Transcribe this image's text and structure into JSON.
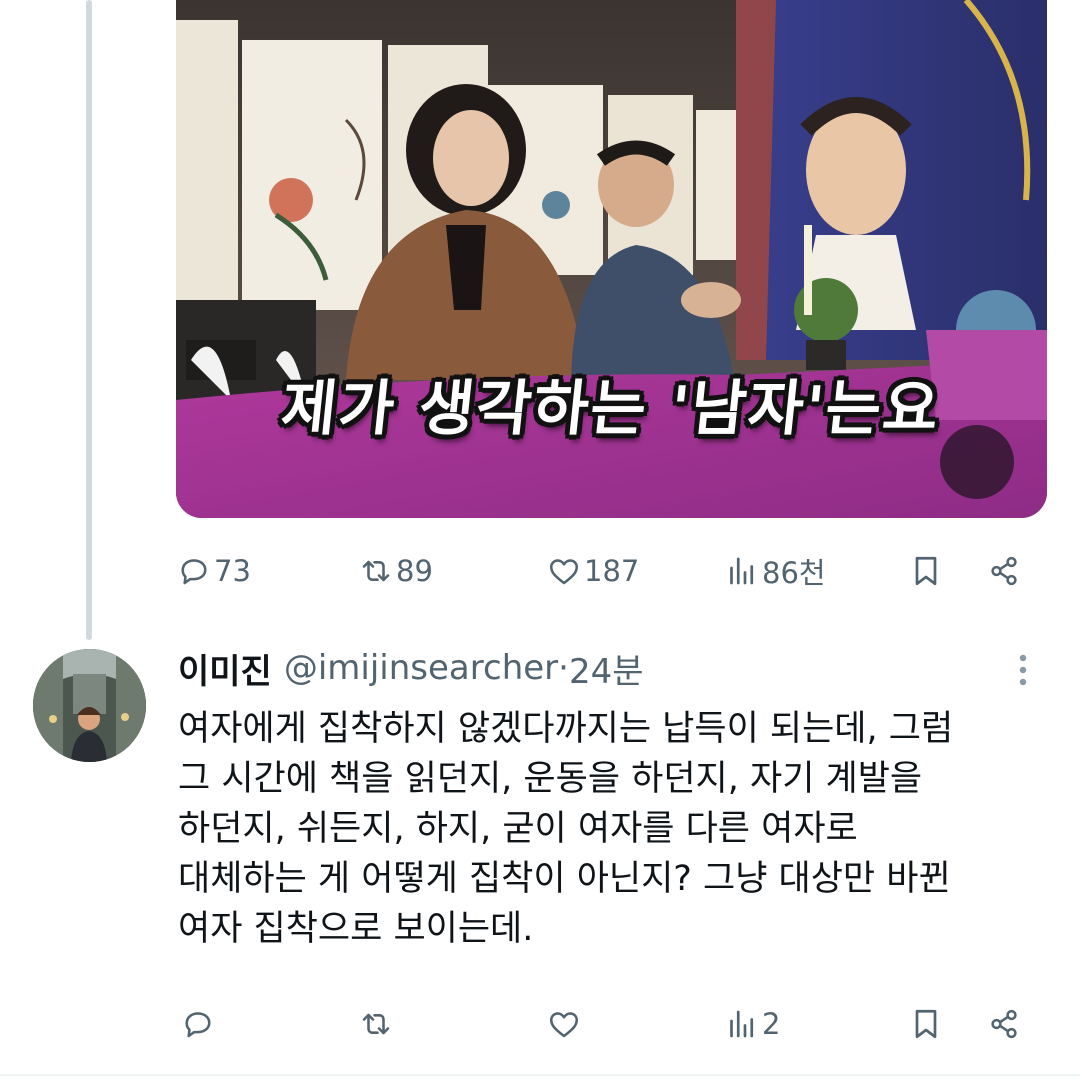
{
  "post": {
    "video_caption": "제가 생각하는 '남자'는요",
    "mute_icon": "speaker-muted-icon",
    "stats": {
      "replies": "73",
      "reposts": "89",
      "likes": "187",
      "views": "86천"
    }
  },
  "reply": {
    "display_name": "이미진",
    "handle": "@imijinsearcher",
    "separator": " · ",
    "time": "24분",
    "text_lines": [
      "여자에게 집착하지 않겠다까지는 납득이 되는데, 그럼",
      "그 시간에 책을 읽던지, 운동을 하던지, 자기 계발을",
      "하던지, 쉬든지, 하지, 굳이 여자를 다른 여자로",
      "대체하는 게 어떻게 집착이 아닌지? 그냥 대상만 바뀐",
      "여자 집착으로 보이는데."
    ],
    "stats": {
      "replies": "",
      "reposts": "",
      "likes": "",
      "views": "2"
    }
  },
  "colors": {
    "text": "#0f1419",
    "secondary": "#536471",
    "thread_line": "#cfd9de"
  }
}
